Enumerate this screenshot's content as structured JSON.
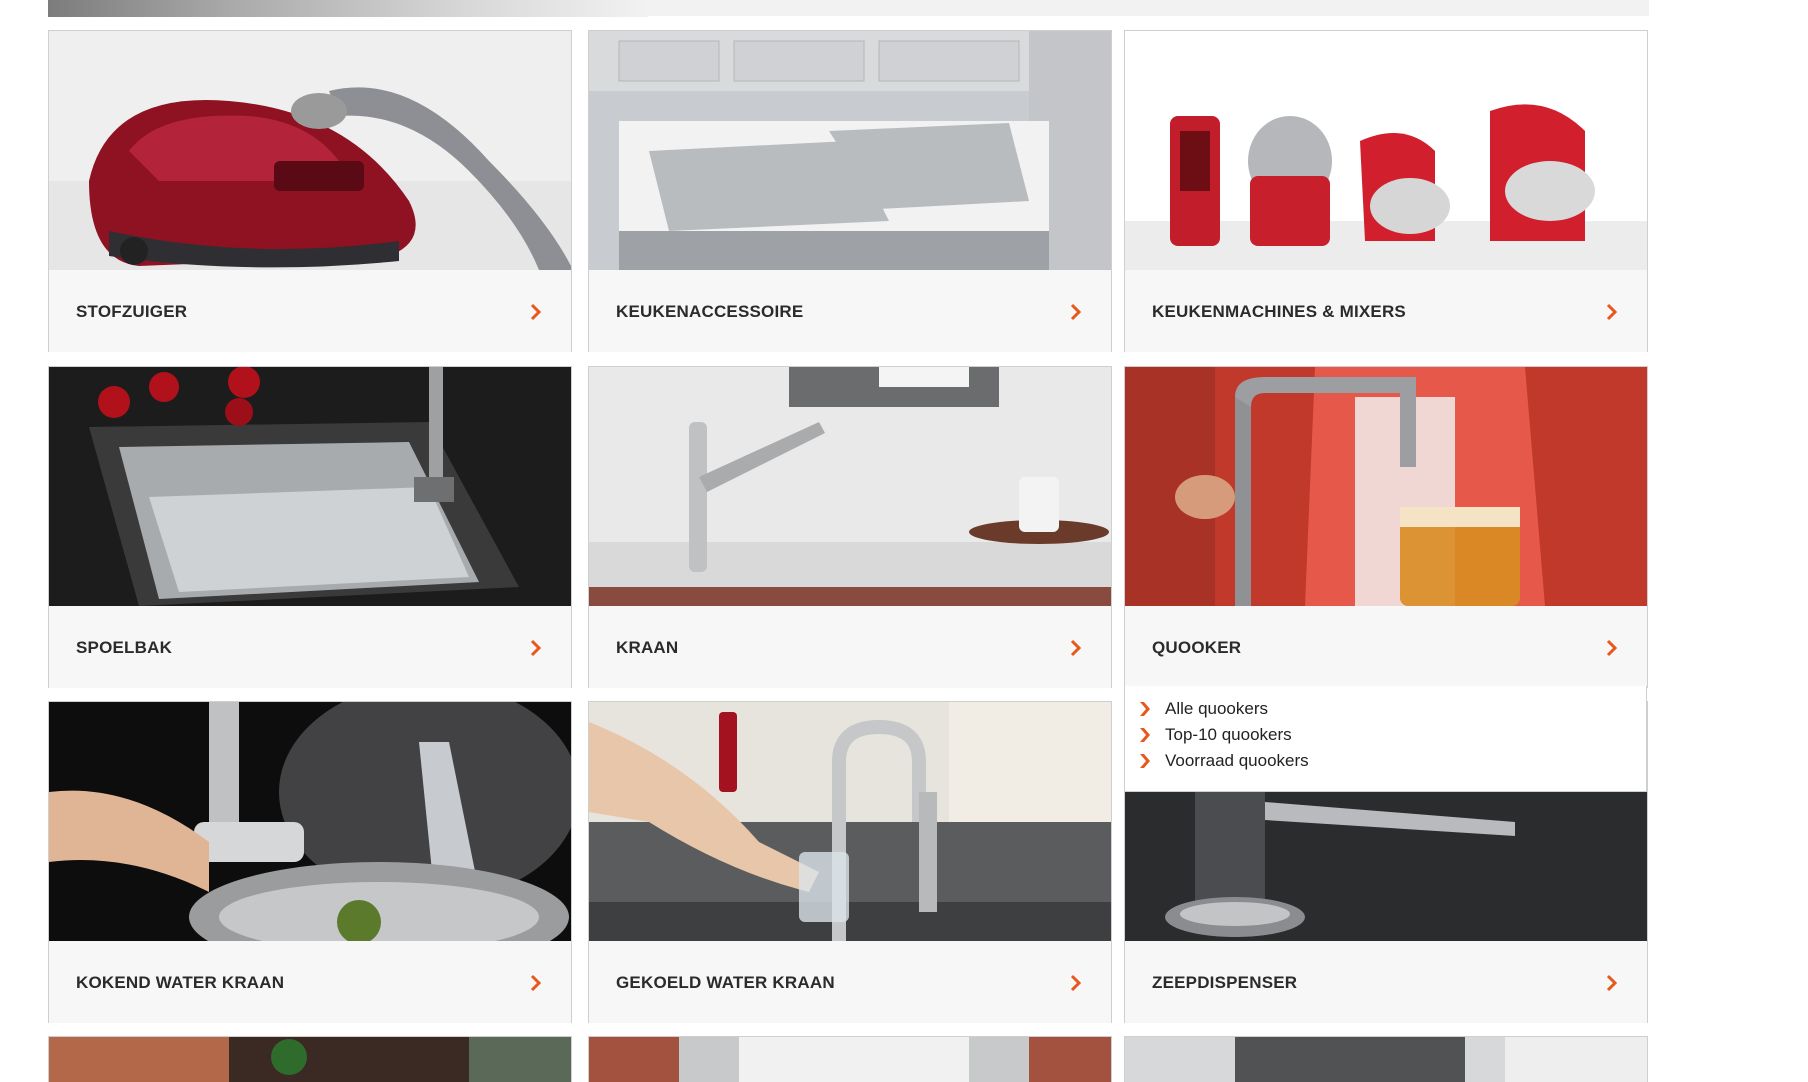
{
  "categories": [
    {
      "label": "STOFZUIGER",
      "image": "red-vacuum-cleaner"
    },
    {
      "label": "KEUKENACCESSOIRE",
      "image": "pull-out-waste-bins"
    },
    {
      "label": "KEUKENMACHINES & MIXERS",
      "image": "red-kitchen-appliances"
    },
    {
      "label": "SPOELBAK",
      "image": "stainless-sink"
    },
    {
      "label": "KRAAN",
      "image": "chrome-faucet"
    },
    {
      "label": "QUOOKER",
      "image": "quooker-boiling-tap"
    },
    {
      "label": "KOKEND WATER KRAAN",
      "image": "boiling-water-tap-pot"
    },
    {
      "label": "GEKOELD WATER KRAAN",
      "image": "chilled-water-tap-glass"
    },
    {
      "label": "ZEEPDISPENSER",
      "image": "soap-dispenser"
    }
  ],
  "quooker_menu": {
    "items": [
      {
        "label": "Alle quookers"
      },
      {
        "label": "Top-10 quookers"
      },
      {
        "label": "Voorraad quookers"
      }
    ]
  },
  "colors": {
    "accent": "#e8581c",
    "label_bg": "#f7f7f7",
    "border": "#cfcfcf"
  }
}
